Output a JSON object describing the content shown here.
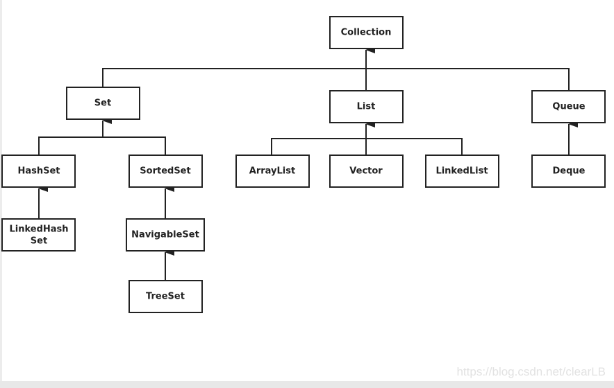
{
  "nodes": {
    "collection": "Collection",
    "set": "Set",
    "list": "List",
    "queue": "Queue",
    "hashset": "HashSet",
    "sortedset": "SortedSet",
    "arraylist": "ArrayList",
    "vector": "Vector",
    "linkedlist": "LinkedList",
    "deque": "Deque",
    "linkedhashset_1": "LinkedHash",
    "linkedhashset_2": "Set",
    "navigableset": "NavigableSet",
    "treeset": "TreeSet"
  },
  "edges": [
    [
      "Set",
      "Collection"
    ],
    [
      "List",
      "Collection"
    ],
    [
      "Queue",
      "Collection"
    ],
    [
      "HashSet",
      "Set"
    ],
    [
      "SortedSet",
      "Set"
    ],
    [
      "ArrayList",
      "List"
    ],
    [
      "Vector",
      "List"
    ],
    [
      "LinkedList",
      "List"
    ],
    [
      "Deque",
      "Queue"
    ],
    [
      "LinkedHashSet",
      "HashSet"
    ],
    [
      "NavigableSet",
      "SortedSet"
    ],
    [
      "TreeSet",
      "NavigableSet"
    ]
  ],
  "watermark": "https://blog.csdn.net/clearLB"
}
